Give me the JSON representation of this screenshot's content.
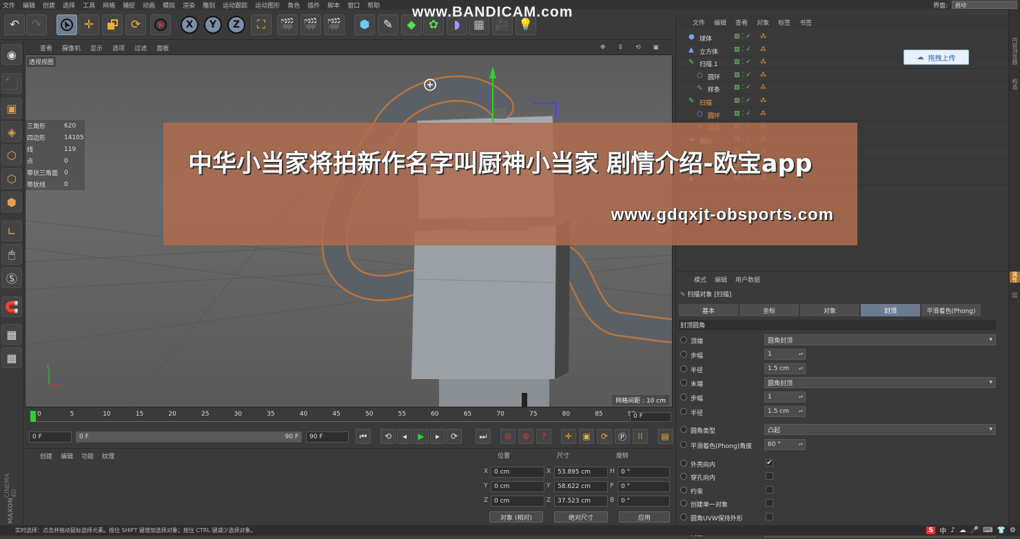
{
  "menubar": {
    "items": [
      "文件",
      "编辑",
      "创建",
      "选择",
      "工具",
      "网格",
      "捕捉",
      "动画",
      "模拟",
      "渲染",
      "雕刻",
      "运动跟踪",
      "运动图形",
      "角色",
      "插件",
      "脚本",
      "窗口",
      "帮助"
    ],
    "layout_label": "界面:",
    "layout_value": "启动"
  },
  "watermark": "www.BANDICAM.com",
  "viewport": {
    "menu": [
      "查看",
      "摄像机",
      "显示",
      "选项",
      "过滤",
      "面板"
    ],
    "label": "透视视图",
    "grid_spacing": "网格间距 : 10 cm",
    "stats": [
      {
        "k": "三角形",
        "v": "620"
      },
      {
        "k": "四边形",
        "v": "14105"
      },
      {
        "k": "线",
        "v": "119"
      },
      {
        "k": "点",
        "v": "0"
      },
      {
        "k": "带状三角面",
        "v": "0"
      },
      {
        "k": "带状线",
        "v": "0"
      }
    ]
  },
  "timeline": {
    "ticks": [
      "0",
      "5",
      "10",
      "15",
      "20",
      "25",
      "30",
      "35",
      "40",
      "45",
      "50",
      "55",
      "60",
      "65",
      "70",
      "75",
      "80",
      "85",
      "90"
    ],
    "current_frame": "0 F",
    "start_field": "0 F",
    "range_start": "0 F",
    "range_end": "90 F",
    "end_field": "90 F"
  },
  "materials": {
    "menu": [
      "创建",
      "编辑",
      "功能",
      "纹理"
    ]
  },
  "coords": {
    "headers": {
      "pos": "位置",
      "size": "尺寸",
      "rot": "旋转"
    },
    "rows": [
      {
        "a": "X",
        "p": "0 cm",
        "s_lab": "X",
        "s": "53.895 cm",
        "r_lab": "H",
        "r": "0 °"
      },
      {
        "a": "Y",
        "p": "0 cm",
        "s_lab": "Y",
        "s": "58.622 cm",
        "r_lab": "P",
        "r": "0 °"
      },
      {
        "a": "Z",
        "p": "0 cm",
        "s_lab": "Z",
        "s": "37.523 cm",
        "r_lab": "B",
        "r": "0 °"
      }
    ],
    "mode_left": "对象 (相对)",
    "mode_mid": "绝对尺寸",
    "apply": "应用"
  },
  "brand": {
    "line1": "MAXON",
    "line2": "CINEMA 4D"
  },
  "status_text": "实时选择：点击并拖动鼠标选择元素。按住 SHIFT 键增加选择对象；按住 CTRL 键减少选择对象。",
  "objects": {
    "menu": [
      "文件",
      "编辑",
      "查看",
      "对象",
      "标签",
      "书签"
    ],
    "rows": [
      {
        "name": "球体",
        "color": "#dddddd"
      },
      {
        "name": "立方体",
        "color": "#dddddd"
      },
      {
        "name": "扫描.1",
        "color": "#dddddd"
      },
      {
        "name": "圆环",
        "color": "#dddddd"
      },
      {
        "name": "样条",
        "color": "#dddddd"
      },
      {
        "name": "扫描",
        "color": "#f0a040"
      },
      {
        "name": "圆环",
        "color": "#f0a040"
      },
      {
        "name": "样条",
        "color": "#f0a040"
      },
      {
        "name": "圆柱",
        "color": "#dddddd"
      },
      {
        "name": "",
        "color": "#dddddd"
      },
      {
        "name": "",
        "color": "#dddddd"
      },
      {
        "name": "",
        "color": "#dddddd"
      }
    ],
    "upload_label": "拖拽上传"
  },
  "attributes": {
    "menu": [
      "模式",
      "编辑",
      "用户数据"
    ],
    "title": "扫描对象 [扫描]",
    "tabs": [
      "基本",
      "坐标",
      "对象",
      "封顶",
      "平滑着色(Phong)"
    ],
    "active_tab": "封顶",
    "section": "封顶圆角",
    "rows": [
      {
        "label": "顶端",
        "value": "圆角封顶",
        "kind": "dd"
      },
      {
        "label": "步幅",
        "value": "1",
        "kind": "sp"
      },
      {
        "label": "半径",
        "value": "1.5 cm",
        "kind": "sp"
      },
      {
        "label": "末端",
        "value": "圆角封顶",
        "kind": "dd"
      },
      {
        "label": "步幅",
        "value": "1",
        "kind": "sp"
      },
      {
        "label": "半径",
        "value": "1.5 cm",
        "kind": "sp"
      },
      {
        "label": "圆角类型",
        "value": "凸起",
        "kind": "dd"
      },
      {
        "label": "平滑着色(Phong)角度",
        "value": "60 °",
        "kind": "sp"
      },
      {
        "label": "外壳向内",
        "value": "✔",
        "kind": "chk"
      },
      {
        "label": "穿孔向内",
        "value": "",
        "kind": "chk"
      },
      {
        "label": "约束",
        "value": "",
        "kind": "chk"
      },
      {
        "label": "创建单一对象",
        "value": "",
        "kind": "chk"
      },
      {
        "label": "圆角UVW保持外形",
        "value": "",
        "kind": "chk"
      },
      {
        "label": "类型",
        "value": "三角形",
        "kind": "dd"
      }
    ]
  },
  "right_tabs": [
    "内容浏览器",
    "构造",
    "属性",
    "层"
  ],
  "overlay": {
    "title": "中华小当家将拍新作名字叫厨神小当家 剧情介绍-欧宝app",
    "url": "www.gdqxjt-obsports.com"
  },
  "tray": [
    "S",
    "中",
    "♪",
    "☁",
    "🎤",
    "⌨",
    "👕",
    "⚙"
  ]
}
